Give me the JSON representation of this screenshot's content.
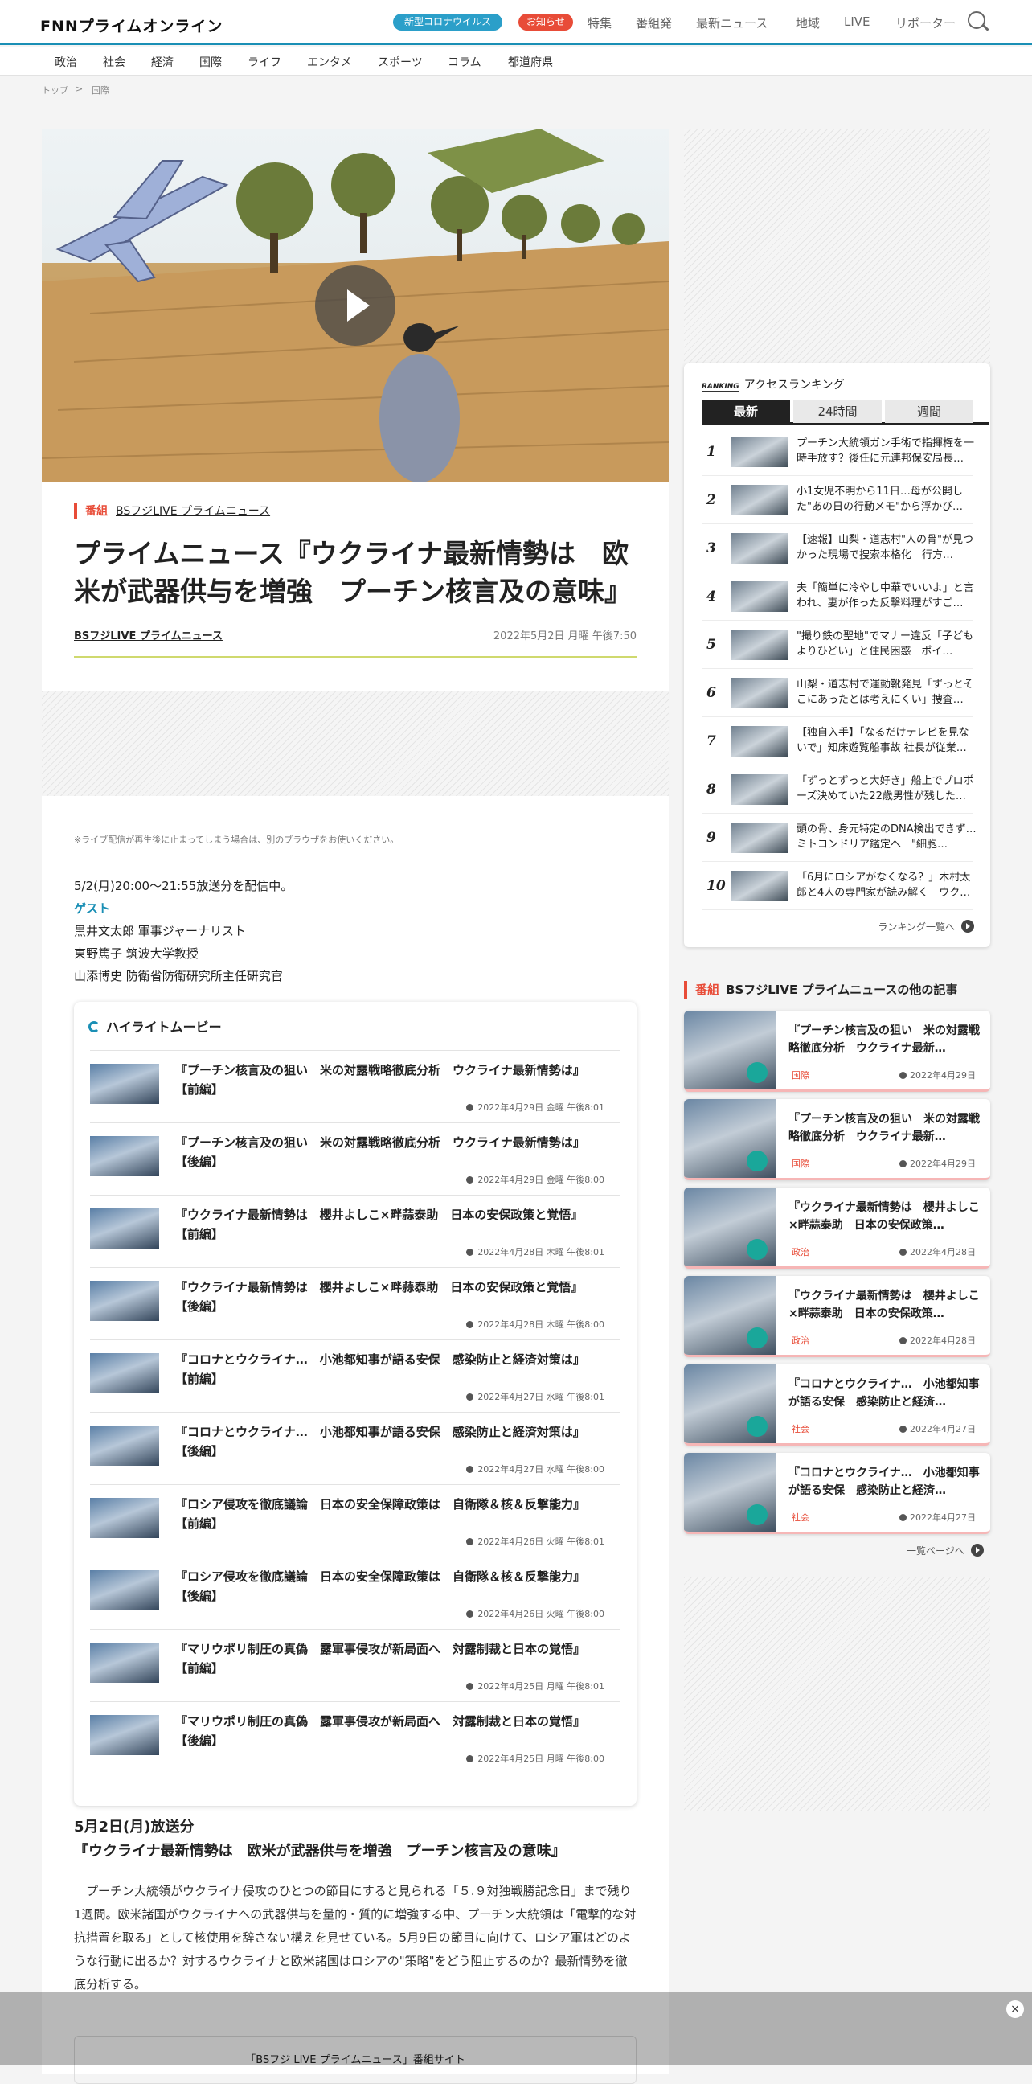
{
  "header": {
    "logo": "FNNプライムオンライン",
    "pill_covid": "新型コロナウイルス",
    "pill_notice": "お知らせ",
    "nav": [
      "特集",
      "番組発",
      "最新ニュース",
      "地域",
      "LIVE",
      "リポーター"
    ]
  },
  "categories": [
    "政治",
    "社会",
    "経済",
    "国際",
    "ライフ",
    "エンタメ",
    "スポーツ",
    "コラム",
    "都道府県"
  ],
  "breadcrumb": {
    "home": "トップ",
    "sep": ">",
    "current": "国際"
  },
  "article": {
    "tag_kind": "番組",
    "program": "BSフジLIVE プライムニュース",
    "title": "プライムニュース『ウクライナ最新情勢は　欧米が武器供与を増強　プーチン核言及の意味』",
    "author": "BSフジLIVE プライムニュース",
    "date": "2022年5月2日 月曜 午後7:50",
    "note": "※ライブ配信が再生後に止まってしまう場合は、別のブラウザをお使いください。",
    "broadcast": "5/2(月)20:00～21:55放送分を配信中。",
    "guest_label": "ゲスト",
    "guests": [
      "黒井文太郎 軍事ジャーナリスト",
      "東野篤子 筑波大学教授",
      "山添博史 防衛省防衛研究所主任研究官"
    ],
    "subhead1": "5月2日(月)放送分",
    "subhead2": "『ウクライナ最新情勢は　欧米が武器供与を増強　プーチン核言及の意味』",
    "body": "プーチン大統領がウクライナ侵攻のひとつの節目にすると見られる「５.９対独戦勝記念日」まで残り1週間。欧米諸国がウクライナへの武器供与を量的・質的に増強する中、プーチン大統領は「電撃的な対抗措置を取る」として核使用を辞さない構えを見せている。5月9日の節目に向けて、ロシア軍はどのような行動に出るか？対するウクライナと欧米諸国はロシアの\"策略\"をどう阻止するのか？最新情勢を徹底分析する。",
    "site_banner": "「BSフジ LIVE プライムニュース」番組サイト"
  },
  "highlight": {
    "heading": "ハイライトムービー",
    "items": [
      {
        "title": "『プーチン核言及の狙い　米の対露戦略徹底分析　ウクライナ最新情勢は』【前編】",
        "date": "2022年4月29日 金曜 午後8:01"
      },
      {
        "title": "『プーチン核言及の狙い　米の対露戦略徹底分析　ウクライナ最新情勢は』【後編】",
        "date": "2022年4月29日 金曜 午後8:00"
      },
      {
        "title": "『ウクライナ最新情勢は　櫻井よしこ×畔蒜泰助　日本の安保政策と覚悟』【前編】",
        "date": "2022年4月28日 木曜 午後8:01"
      },
      {
        "title": "『ウクライナ最新情勢は　櫻井よしこ×畔蒜泰助　日本の安保政策と覚悟』【後編】",
        "date": "2022年4月28日 木曜 午後8:00"
      },
      {
        "title": "『コロナとウクライナ…　小池都知事が語る安保　感染防止と経済対策は』【前編】",
        "date": "2022年4月27日 水曜 午後8:01"
      },
      {
        "title": "『コロナとウクライナ…　小池都知事が語る安保　感染防止と経済対策は』【後編】",
        "date": "2022年4月27日 水曜 午後8:00"
      },
      {
        "title": "『ロシア侵攻を徹底議論　日本の安全保障政策は　自衛隊＆核＆反撃能力』【前編】",
        "date": "2022年4月26日 火曜 午後8:01"
      },
      {
        "title": "『ロシア侵攻を徹底議論　日本の安全保障政策は　自衛隊＆核＆反撃能力』【後編】",
        "date": "2022年4月26日 火曜 午後8:00"
      },
      {
        "title": "『マリウポリ制圧の真偽　露軍事侵攻が新局面へ　対露制裁と日本の覚悟』【前編】",
        "date": "2022年4月25日 月曜 午後8:01"
      },
      {
        "title": "『マリウポリ制圧の真偽　露軍事侵攻が新局面へ　対露制裁と日本の覚悟』【後編】",
        "date": "2022年4月25日 月曜 午後8:00"
      }
    ]
  },
  "ranking": {
    "badge": "RANKING",
    "heading": "アクセスランキング",
    "tabs": [
      "最新",
      "24時間",
      "週間"
    ],
    "items": [
      {
        "rank": "1",
        "title": "プーチン大統領ガン手術で指揮権を一時手放す？後任に元連邦保安局長…"
      },
      {
        "rank": "2",
        "title": "小1女児不明から11日…母が公開した\"あの日の行動メモ\"から浮かび…"
      },
      {
        "rank": "3",
        "title": "【速報】山梨・道志村\"人の骨\"が見つかった現場で捜索本格化　行方…"
      },
      {
        "rank": "4",
        "title": "夫「簡単に冷やし中華でいいよ」と言われ、妻が作った反撃料理がすご…"
      },
      {
        "rank": "5",
        "title": "\"撮り鉄の聖地\"でマナー違反「子どもよりひどい」と住民困惑　ポイ…"
      },
      {
        "rank": "6",
        "title": "山梨・道志村で運動靴発見「ずっとそこにあったとは考えにくい」捜査…"
      },
      {
        "rank": "7",
        "title": "【独自入手】「なるだけテレビを見ないで」知床遊覧船事故 社長が従業…"
      },
      {
        "rank": "8",
        "title": "「ずっとずっと大好き」船上でプロポーズ決めていた22歳男性が残した…"
      },
      {
        "rank": "9",
        "title": "頭の骨、身元特定のDNA検出できず…ミトコンドリア鑑定へ　\"細胞…"
      },
      {
        "rank": "10",
        "title": "「6月にロシアがなくなる？」木村太郎と4人の専門家が読み解く　ウク…"
      }
    ],
    "more": "ランキング一覧へ"
  },
  "other": {
    "tag_kind": "番組",
    "heading": "BSフジLIVE プライムニュースの他の記事",
    "items": [
      {
        "title": "『プーチン核言及の狙い　米の対露戦略徹底分析　ウクライナ最新…",
        "cat": "国際",
        "date": "2022年4月29日"
      },
      {
        "title": "『プーチン核言及の狙い　米の対露戦略徹底分析　ウクライナ最新…",
        "cat": "国際",
        "date": "2022年4月29日"
      },
      {
        "title": "『ウクライナ最新情勢は　櫻井よしこ×畔蒜泰助　日本の安保政策…",
        "cat": "政治",
        "date": "2022年4月28日"
      },
      {
        "title": "『ウクライナ最新情勢は　櫻井よしこ×畔蒜泰助　日本の安保政策…",
        "cat": "政治",
        "date": "2022年4月28日"
      },
      {
        "title": "『コロナとウクライナ…　小池都知事が語る安保　感染防止と経済…",
        "cat": "社会",
        "date": "2022年4月27日"
      },
      {
        "title": "『コロナとウクライナ…　小池都知事が語る安保　感染防止と経済…",
        "cat": "社会",
        "date": "2022年4月27日"
      }
    ],
    "more": "一覧ページへ"
  },
  "overlay": {
    "close": "×"
  }
}
